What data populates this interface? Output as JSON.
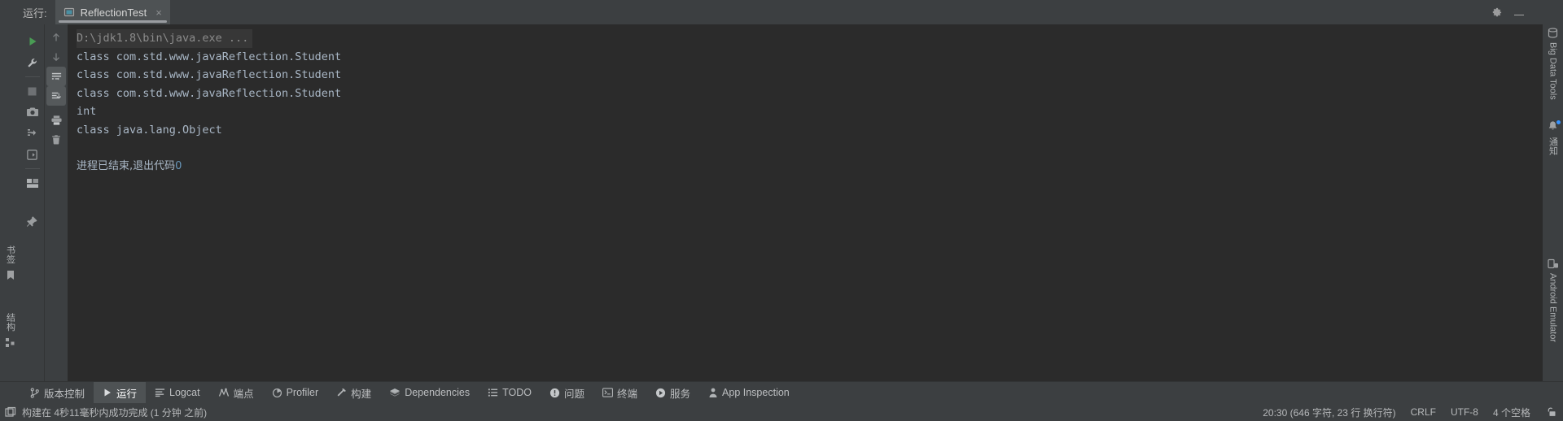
{
  "window": {
    "run_label": "运行:",
    "settings_icon": "gear-icon",
    "minimize_icon": "minimize-icon"
  },
  "tab": {
    "title": "ReflectionTest",
    "icon": "run-configuration-icon",
    "close": "×"
  },
  "run_toolbar": {
    "items": [
      {
        "name": "rerun-button",
        "icon": "play-icon"
      },
      {
        "name": "edit-configurations-button",
        "icon": "wrench-icon"
      },
      {
        "name": "stop-button",
        "icon": "stop-square-icon"
      },
      {
        "name": "screenshot-button",
        "icon": "camera-icon"
      },
      {
        "name": "debug-dump-button",
        "icon": "thread-dump-icon"
      },
      {
        "name": "attach-debugger-button",
        "icon": "enter-arrow-icon"
      },
      {
        "name": "layout-settings-button",
        "icon": "layout-icon"
      },
      {
        "name": "pin-tab-button",
        "icon": "pin-icon"
      }
    ]
  },
  "console_toolbar": {
    "items": [
      {
        "name": "scroll-up-button",
        "icon": "arrow-up-icon",
        "active": false
      },
      {
        "name": "scroll-down-button",
        "icon": "arrow-down-icon",
        "active": false
      },
      {
        "name": "soft-wrap-button",
        "icon": "soft-wrap-icon",
        "active": true
      },
      {
        "name": "scroll-to-end-button",
        "icon": "scroll-to-end-icon",
        "active": true
      },
      {
        "name": "print-button",
        "icon": "printer-icon",
        "active": false
      },
      {
        "name": "clear-all-button",
        "icon": "trash-icon",
        "active": false
      }
    ]
  },
  "console": {
    "command_line": "D:\\jdk1.8\\bin\\java.exe ...",
    "lines": [
      "class com.std.www.javaReflection.Student",
      "class com.std.www.javaReflection.Student",
      "class com.std.www.javaReflection.Student",
      "int",
      "class java.lang.Object"
    ],
    "exit_message_text": "进程已结束,退出代码",
    "exit_code": "0"
  },
  "left_sidebar": {
    "items": [
      {
        "name": "sidebar-item-bookmarks",
        "label": "书签",
        "icon": "bookmark-icon"
      },
      {
        "name": "sidebar-item-structure",
        "label": "结构",
        "icon": "structure-icon"
      }
    ]
  },
  "right_sidebar": {
    "items": [
      {
        "name": "sidebar-item-big-data-tools",
        "label": "Big Data Tools",
        "icon": "big-data-icon"
      },
      {
        "name": "sidebar-item-notifications",
        "label": "通知",
        "icon": "bell-icon",
        "badge": true
      },
      {
        "name": "sidebar-item-android-emulator",
        "label": "Android Emulator",
        "icon": "emulator-icon"
      }
    ]
  },
  "bottom_toolbar": {
    "items": [
      {
        "name": "tool-window-version-control",
        "label": "版本控制",
        "icon": "branch-icon",
        "active": false
      },
      {
        "name": "tool-window-run",
        "label": "运行",
        "icon": "play-icon",
        "active": true
      },
      {
        "name": "tool-window-logcat",
        "label": "Logcat",
        "icon": "logcat-icon",
        "active": false
      },
      {
        "name": "tool-window-endpoints",
        "label": "端点",
        "icon": "endpoints-icon",
        "active": false
      },
      {
        "name": "tool-window-profiler",
        "label": "Profiler",
        "icon": "profiler-icon",
        "active": false
      },
      {
        "name": "tool-window-build",
        "label": "构建",
        "icon": "hammer-icon",
        "active": false
      },
      {
        "name": "tool-window-dependencies",
        "label": "Dependencies",
        "icon": "layers-icon",
        "active": false
      },
      {
        "name": "tool-window-todo",
        "label": "TODO",
        "icon": "todo-list-icon",
        "active": false
      },
      {
        "name": "tool-window-problems",
        "label": "问题",
        "icon": "warning-icon",
        "active": false
      },
      {
        "name": "tool-window-terminal",
        "label": "终端",
        "icon": "terminal-icon",
        "active": false
      },
      {
        "name": "tool-window-services",
        "label": "服务",
        "icon": "services-play-icon",
        "active": false
      },
      {
        "name": "tool-window-app-inspection",
        "label": "App Inspection",
        "icon": "inspection-icon",
        "active": false
      }
    ]
  },
  "status_bar": {
    "build_icon": "build-status-icon",
    "build_message": "构建在 4秒11毫秒内成功完成 (1 分钟 之前)",
    "caret_position": "20:30 (646 字符, 23 行 换行符)",
    "line_separator": "CRLF",
    "encoding": "UTF-8",
    "indent": "4 个空格",
    "lock_icon": "lock-icon"
  },
  "colors": {
    "background": "#3c3f41",
    "console_background": "#2b2b2b",
    "console_text": "#a9b7c6",
    "accent_green": "#499c54",
    "accent_blue": "#3592ff",
    "number_blue": "#6897bb"
  }
}
